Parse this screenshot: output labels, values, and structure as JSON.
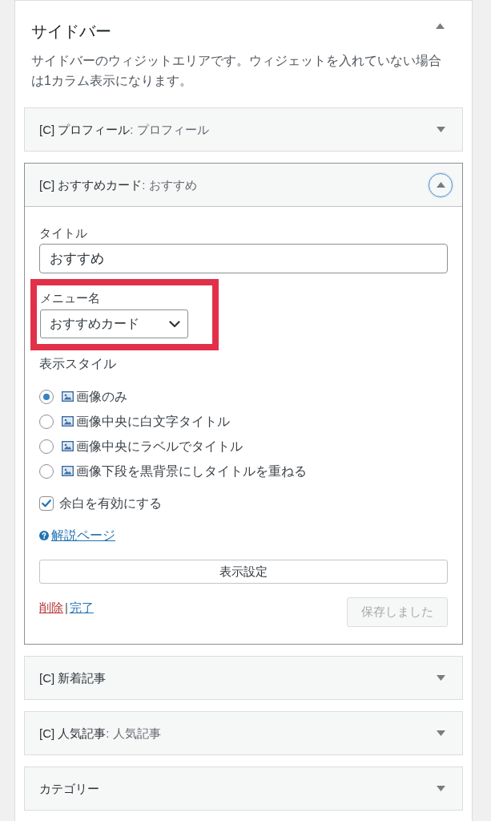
{
  "panel": {
    "title": "サイドバー",
    "expanded": true,
    "description": "サイドバーのウィジットエリアです。ウィジェットを入れていない場合は1カラム表示になります。"
  },
  "widgets": [
    {
      "name": "[C] プロフィール",
      "instance_title": ": プロフィール",
      "expanded": false
    },
    {
      "name": "[C] おすすめカード",
      "instance_title": ": おすすめ",
      "expanded": true,
      "form": {
        "title_field": {
          "label": "タイトル",
          "value": "おすすめ"
        },
        "menu_field": {
          "label": "メニュー名",
          "value": "おすすめカード",
          "highlighted": true
        },
        "style_label": "表示スタイル",
        "styles": [
          {
            "label": "画像のみ",
            "selected": true
          },
          {
            "label": "画像中央に白文字タイトル",
            "selected": false
          },
          {
            "label": "画像中央にラベルでタイトル",
            "selected": false
          },
          {
            "label": "画像下段を黒背景にしタイトルを重ねる",
            "selected": false
          }
        ],
        "margin_option": {
          "label": "余白を有効にする",
          "checked": true
        },
        "help_link": "解説ページ",
        "settings_button": "表示設定",
        "delete_link": "削除",
        "separator": "|",
        "done_link": "完了",
        "save_button": {
          "label": "保存しました",
          "disabled": true
        }
      }
    },
    {
      "name": "[C] 新着記事",
      "expanded": false
    },
    {
      "name": "[C] 人気記事",
      "instance_title": ": 人気記事",
      "expanded": false
    },
    {
      "name": "カテゴリー",
      "expanded": false
    }
  ]
}
